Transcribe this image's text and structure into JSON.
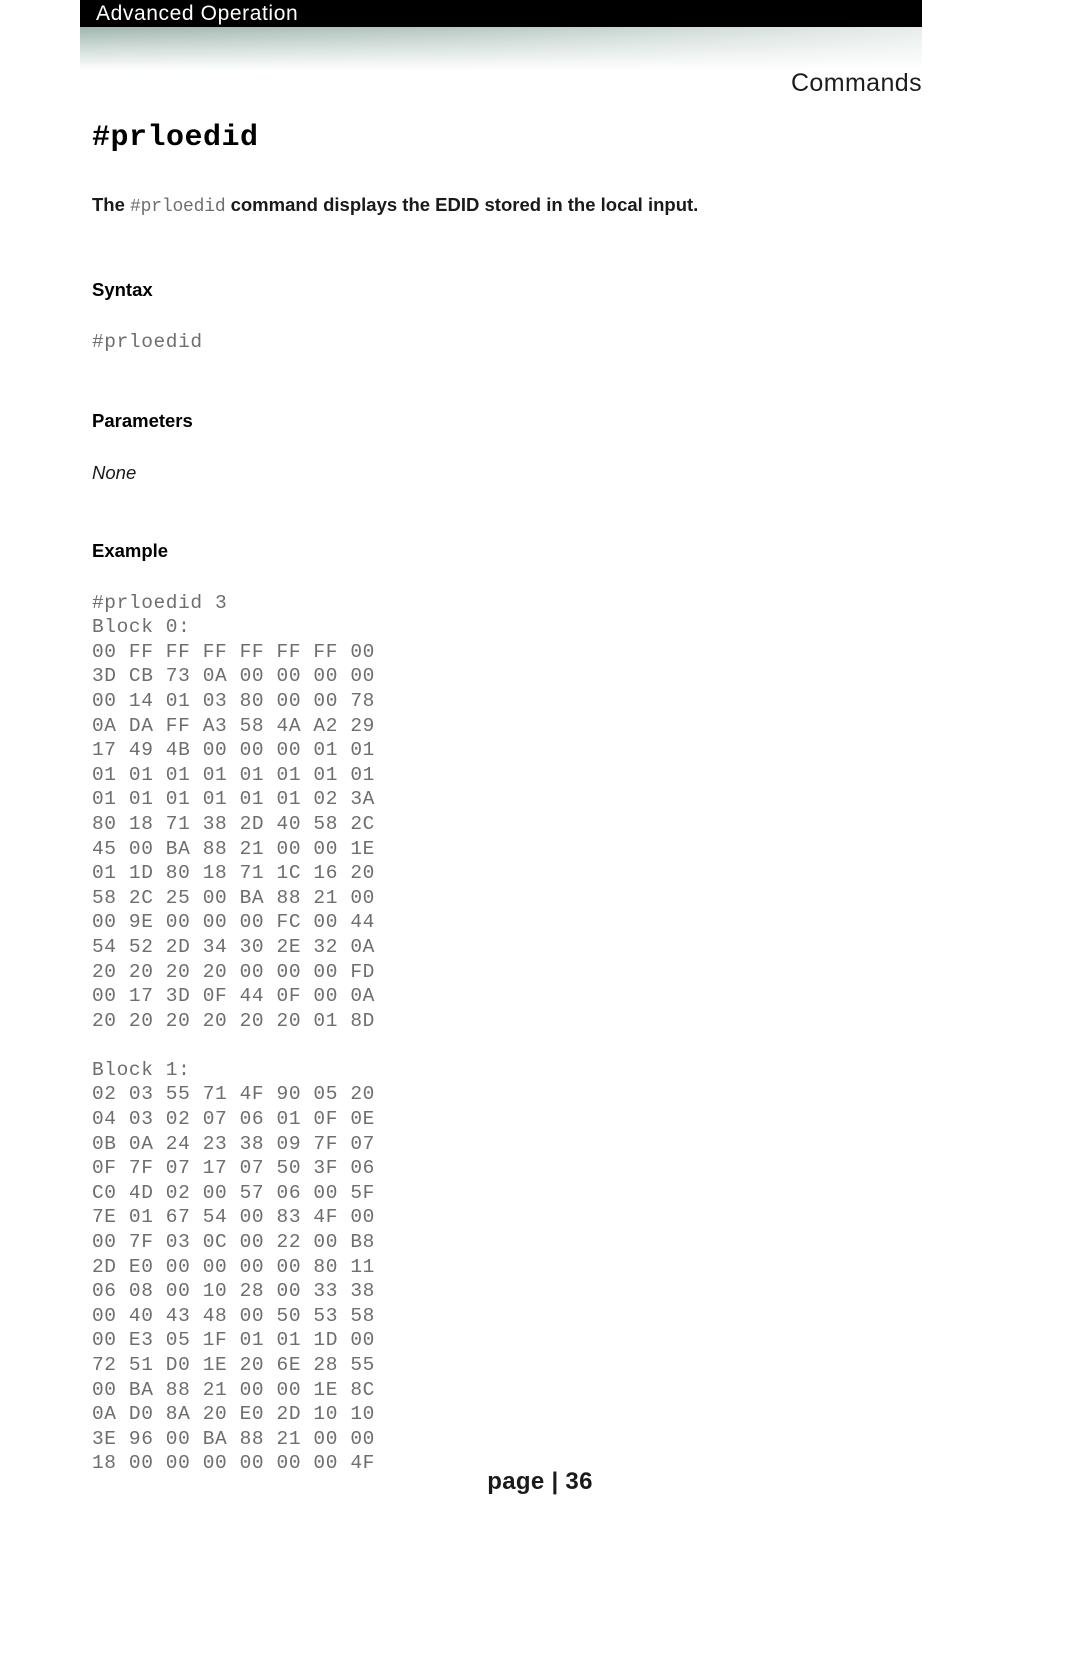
{
  "header": {
    "chapter_title": "Advanced Operation",
    "section_title": "Commands"
  },
  "page": {
    "command_title": "#prloedid",
    "intro": {
      "lead": "The ",
      "command": "#prloedid",
      "rest": " command displays the EDID stored in the local input."
    },
    "sections": {
      "syntax_heading": "Syntax",
      "syntax_code": "#prloedid",
      "parameters_heading": "Parameters",
      "parameters_value": "None",
      "example_heading": "Example"
    },
    "example": {
      "command_line": "#prloedid 3",
      "block0_label": "Block 0:",
      "block0_rows": [
        "00 FF FF FF FF FF FF 00",
        "3D CB 73 0A 00 00 00 00",
        "00 14 01 03 80 00 00 78",
        "0A DA FF A3 58 4A A2 29",
        "17 49 4B 00 00 00 01 01",
        "01 01 01 01 01 01 01 01",
        "01 01 01 01 01 01 02 3A",
        "80 18 71 38 2D 40 58 2C",
        "45 00 BA 88 21 00 00 1E",
        "01 1D 80 18 71 1C 16 20",
        "58 2C 25 00 BA 88 21 00",
        "00 9E 00 00 00 FC 00 44",
        "54 52 2D 34 30 2E 32 0A",
        "20 20 20 20 00 00 00 FD",
        "00 17 3D 0F 44 0F 00 0A",
        "20 20 20 20 20 20 01 8D"
      ],
      "block1_label": "Block 1:",
      "block1_rows": [
        "02 03 55 71 4F 90 05 20",
        "04 03 02 07 06 01 0F 0E",
        "0B 0A 24 23 38 09 7F 07",
        "0F 7F 07 17 07 50 3F 06",
        "C0 4D 02 00 57 06 00 5F",
        "7E 01 67 54 00 83 4F 00",
        "00 7F 03 0C 00 22 00 B8",
        "2D E0 00 00 00 00 80 11",
        "06 08 00 10 28 00 33 38",
        "00 40 43 48 00 50 53 58",
        "00 E3 05 1F 01 01 1D 00",
        "72 51 D0 1E 20 6E 28 55",
        "00 BA 88 21 00 00 1E 8C",
        "0A D0 8A 20 E0 2D 10 10",
        "3E 96 00 BA 88 21 00 00",
        "18 00 00 00 00 00 00 4F"
      ]
    }
  },
  "footer": {
    "text": "page | 36"
  },
  "colors": {
    "header_bar_bg": "#000000",
    "header_bar_text": "#ffffff",
    "gradient_top": "#9fb6ad",
    "gradient_bottom": "#ffffff",
    "code_text": "#6e6e6e",
    "body_text": "#1a1a1a"
  }
}
